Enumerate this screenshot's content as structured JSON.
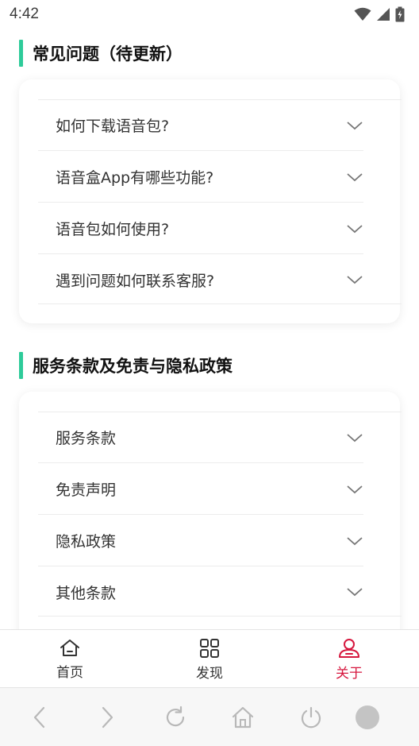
{
  "status_bar": {
    "time": "4:42"
  },
  "faq": {
    "title": "常见问题（待更新）",
    "items": [
      {
        "label": "如何下载语音包?"
      },
      {
        "label": "语音盒App有哪些功能?"
      },
      {
        "label": "语音包如何使用?"
      },
      {
        "label": "遇到问题如何联系客服?"
      }
    ]
  },
  "terms": {
    "title": "服务条款及免责与隐私政策",
    "items": [
      {
        "label": "服务条款"
      },
      {
        "label": "免责声明"
      },
      {
        "label": "隐私政策"
      },
      {
        "label": "其他条款"
      }
    ]
  },
  "tabbar": {
    "tabs": [
      {
        "label": "首页",
        "icon": "home-icon"
      },
      {
        "label": "发现",
        "icon": "grid-icon"
      },
      {
        "label": "关于",
        "icon": "user-icon"
      }
    ],
    "active_color": "#d6173e"
  },
  "browser_nav": {
    "icons": [
      "back-icon",
      "forward-icon",
      "reload-icon",
      "home-icon",
      "power-icon",
      "circle-icon"
    ]
  },
  "colors": {
    "accent": "#2ecb9a",
    "active_tab": "#d6173e"
  }
}
